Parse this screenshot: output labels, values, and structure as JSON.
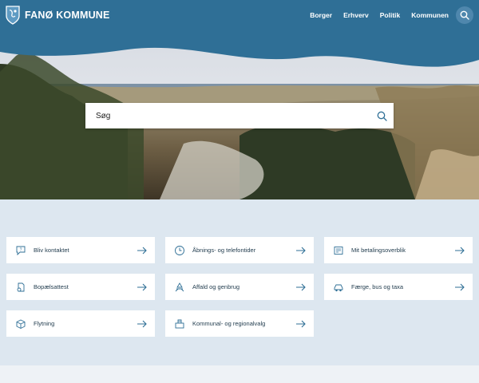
{
  "header": {
    "logo_text": "FANØ KOMMUNE",
    "nav": [
      "Borger",
      "Erhverv",
      "Politik",
      "Kommunen"
    ],
    "search_icon": "search-icon",
    "color": "#2f6f96"
  },
  "search": {
    "placeholder": "Søg",
    "button_icon": "search-icon"
  },
  "cards": [
    {
      "label": "Bliv kontaktet",
      "icon": "chat-question-icon"
    },
    {
      "label": "Åbnings- og telefontider",
      "icon": "clock-icon"
    },
    {
      "label": "Mit betalingsoverblik",
      "icon": "payment-overview-icon"
    },
    {
      "label": "Bopælsattest",
      "icon": "residence-certificate-icon"
    },
    {
      "label": "Affald og genbrug",
      "icon": "recycle-icon"
    },
    {
      "label": "Færge, bus og taxa",
      "icon": "transport-icon"
    },
    {
      "label": "Flytning",
      "icon": "moving-box-icon"
    },
    {
      "label": "Kommunal- og regionalvalg",
      "icon": "ballot-box-icon"
    }
  ]
}
